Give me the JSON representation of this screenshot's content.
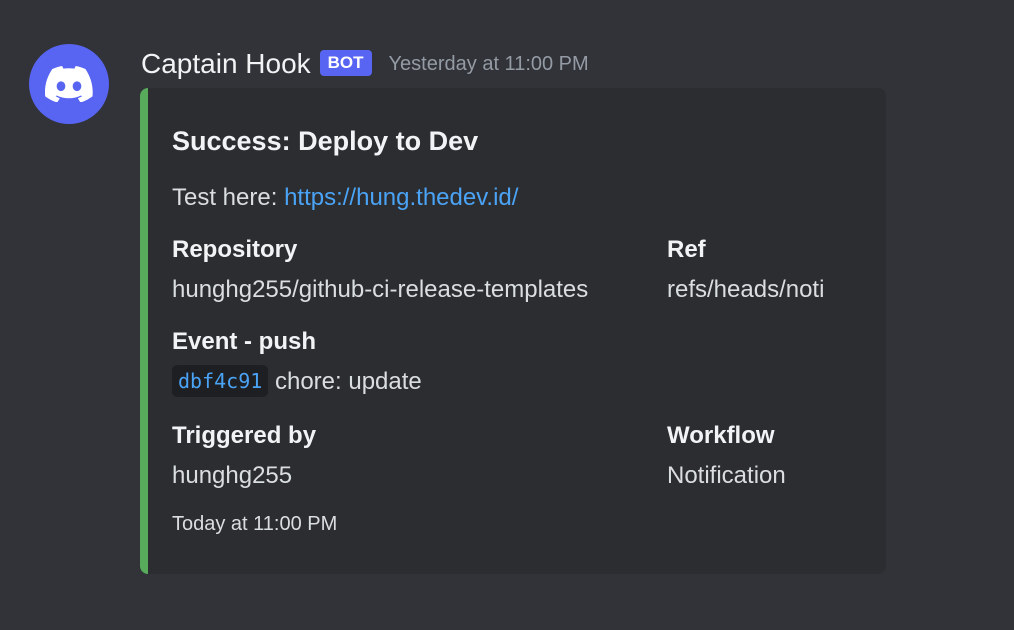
{
  "message": {
    "username": "Captain Hook",
    "badge": "BOT",
    "timestamp": "Yesterday at 11:00 PM",
    "avatar_icon": "discord-logo-icon",
    "avatar_color": "#5865f2"
  },
  "embed": {
    "accent_color": "#57ab5a",
    "title": "Success: Deploy to Dev",
    "description_prefix": "Test here: ",
    "description_link": "https://hung.thedev.id/",
    "fields": {
      "repository": {
        "name": "Repository",
        "value": "hunghg255/github-ci-release-templates"
      },
      "ref": {
        "name": "Ref",
        "value": "refs/heads/noti"
      },
      "event": {
        "name": "Event - push",
        "commit_hash": "dbf4c91",
        "commit_message": "chore: update"
      },
      "triggered_by": {
        "name": "Triggered by",
        "value": "hunghg255"
      },
      "workflow": {
        "name": "Workflow",
        "value": "Notification"
      }
    },
    "footer": "Today at 11:00 PM"
  }
}
